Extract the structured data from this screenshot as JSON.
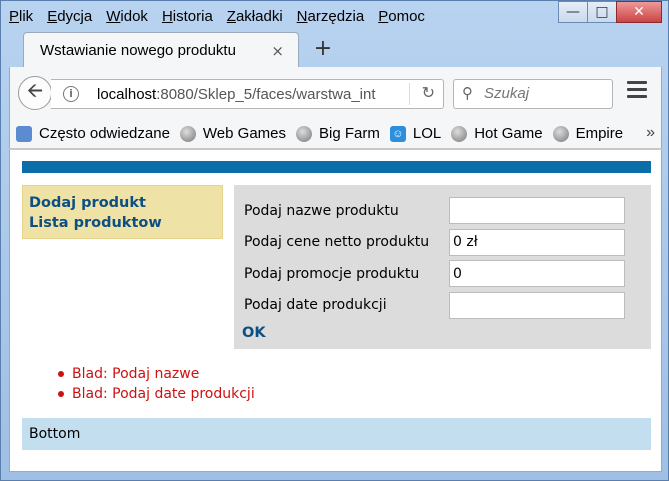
{
  "menubar": {
    "items": [
      "Plik",
      "Edycja",
      "Widok",
      "Historia",
      "Zakładki",
      "Narzędzia",
      "Pomoc"
    ]
  },
  "tab": {
    "title": "Wstawianie nowego produktu",
    "close": "×",
    "new": "+"
  },
  "address": {
    "host": "localhost",
    "path": ":8080/Sklep_5/faces/warstwa_int",
    "reload": "↻"
  },
  "search": {
    "placeholder": "Szukaj"
  },
  "bookmarks": {
    "items": [
      "Często odwiedzane",
      "Web Games",
      "Big Farm",
      "LOL",
      "Hot Game",
      "Empire"
    ],
    "more": "»"
  },
  "page": {
    "menu": {
      "add_product": "Dodaj produkt",
      "list_products": "Lista produktow"
    },
    "form": {
      "fields": [
        {
          "label": "Podaj nazwe produktu",
          "value": ""
        },
        {
          "label": "Podaj cene netto produktu",
          "value": "0 zł"
        },
        {
          "label": "Podaj promocje produktu",
          "value": "0"
        },
        {
          "label": "Podaj date produkcji",
          "value": ""
        }
      ],
      "submit": "OK"
    },
    "errors": [
      "Blad: Podaj nazwe",
      "Blad: Podaj date produkcji"
    ],
    "footer": "Bottom"
  },
  "colors": {
    "header_strip": "#0b6ea8",
    "menu_bg": "#efe2a6",
    "form_bg": "#dcdcdc",
    "error": "#cc1111",
    "footer_bg": "#c2deef",
    "link": "#0d4f82"
  }
}
